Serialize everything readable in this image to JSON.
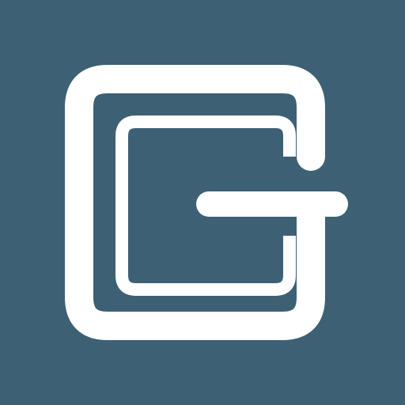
{
  "icon": {
    "name": "g-logo-icon",
    "background_color": "#3d6074",
    "foreground_color": "#ffffff",
    "letter": "G"
  }
}
